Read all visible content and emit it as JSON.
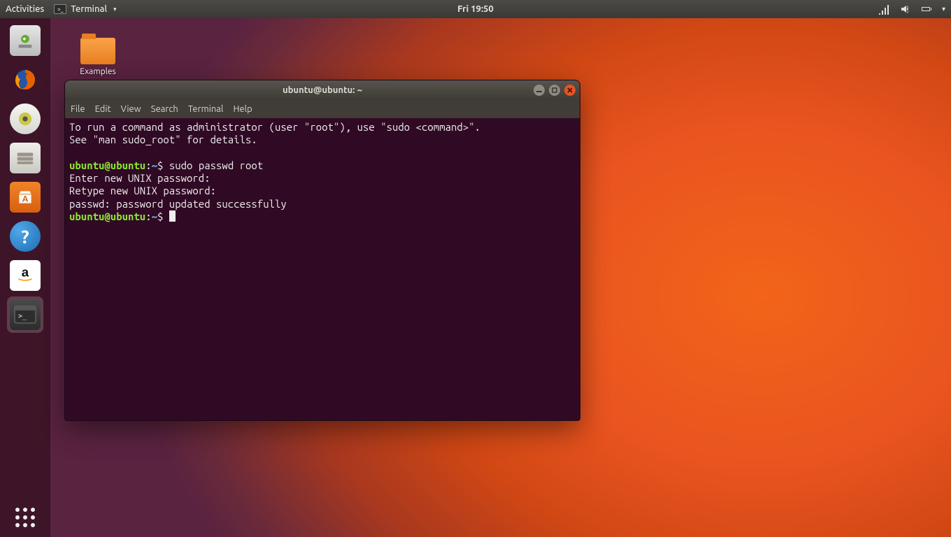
{
  "top_panel": {
    "activities": "Activities",
    "app_label": "Terminal",
    "clock": "Fri 19:50"
  },
  "desktop": {
    "examples_label": "Examples"
  },
  "terminal": {
    "title": "ubuntu@ubuntu: ~",
    "menus": {
      "file": "File",
      "edit": "Edit",
      "view": "View",
      "search": "Search",
      "terminal": "Terminal",
      "help": "Help"
    },
    "lines": {
      "l1": "To run a command as administrator (user \"root\"), use \"sudo <command>\".",
      "l2": "See \"man sudo_root\" for details.",
      "blank": "",
      "p1_user": "ubuntu@ubuntu",
      "p1_colon": ":",
      "p1_path": "~",
      "p1_dollar": "$ ",
      "p1_cmd": "sudo passwd root",
      "l3": "Enter new UNIX password: ",
      "l4": "Retype new UNIX password: ",
      "l5": "passwd: password updated successfully",
      "p2_user": "ubuntu@ubuntu",
      "p2_colon": ":",
      "p2_path": "~",
      "p2_dollar": "$ "
    }
  },
  "colors": {
    "terminal_bg": "#300a24",
    "prompt_user": "#8ae234",
    "prompt_path": "#729fcf",
    "close_button": "#e95420"
  }
}
